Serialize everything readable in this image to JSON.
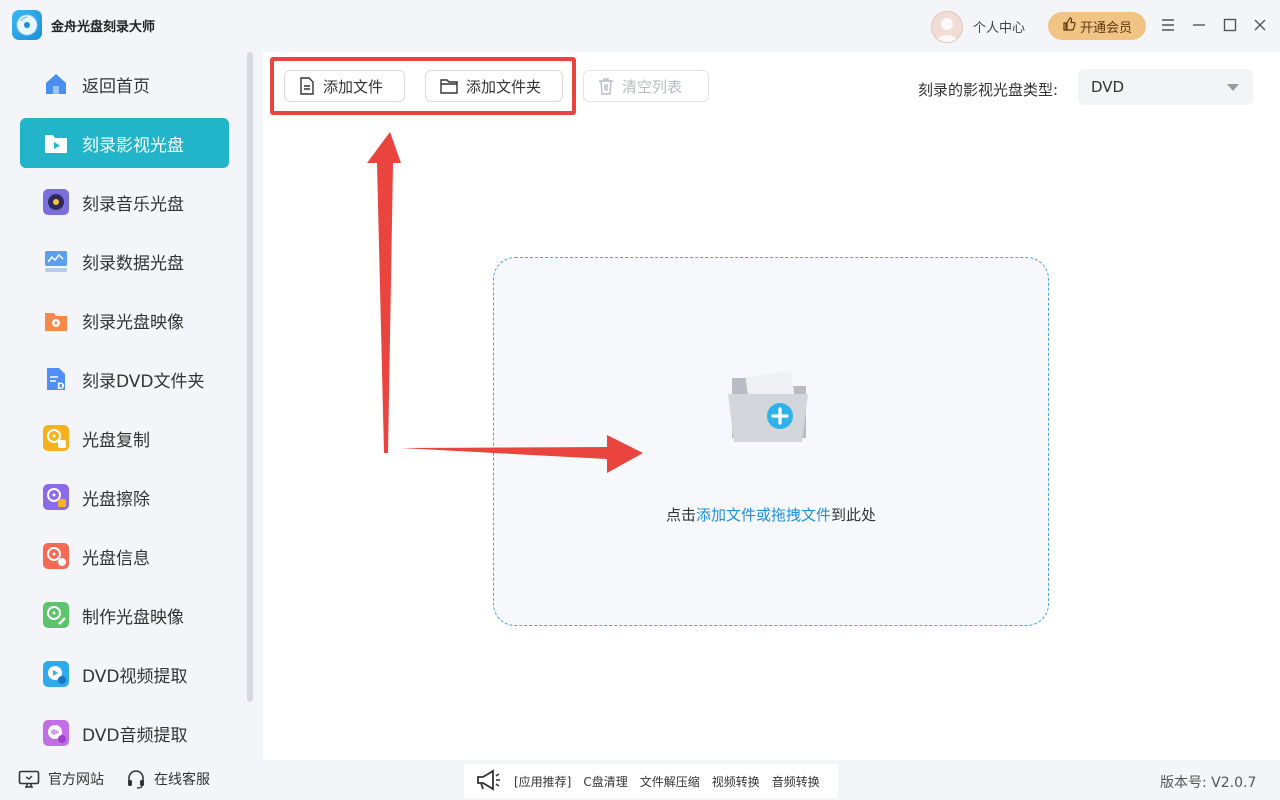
{
  "app": {
    "title": "金舟光盘刻录大师"
  },
  "header": {
    "user_center": "个人中心",
    "vip_label": "开通会员"
  },
  "sidebar": {
    "items": [
      {
        "label": "返回首页"
      },
      {
        "label": "刻录影视光盘"
      },
      {
        "label": "刻录音乐光盘"
      },
      {
        "label": "刻录数据光盘"
      },
      {
        "label": "刻录光盘映像"
      },
      {
        "label": "刻录DVD文件夹"
      },
      {
        "label": "光盘复制"
      },
      {
        "label": "光盘擦除"
      },
      {
        "label": "光盘信息"
      },
      {
        "label": "制作光盘映像"
      },
      {
        "label": "DVD视频提取"
      },
      {
        "label": "DVD音频提取"
      }
    ]
  },
  "toolbar": {
    "add_file": "添加文件",
    "add_folder": "添加文件夹",
    "clear_list": "清空列表",
    "disc_type_label": "刻录的影视光盘类型:",
    "disc_type_value": "DVD"
  },
  "dropzone": {
    "prefix": "点击",
    "link": "添加文件或拖拽文件",
    "suffix": "到此处"
  },
  "footer": {
    "official_site": "官方网站",
    "online_service": "在线客服",
    "recommend_label": "[应用推荐]",
    "recommend_items": [
      "C盘清理",
      "文件解压缩",
      "视频转换",
      "音频转换"
    ],
    "version": "版本号:  V2.0.7"
  }
}
